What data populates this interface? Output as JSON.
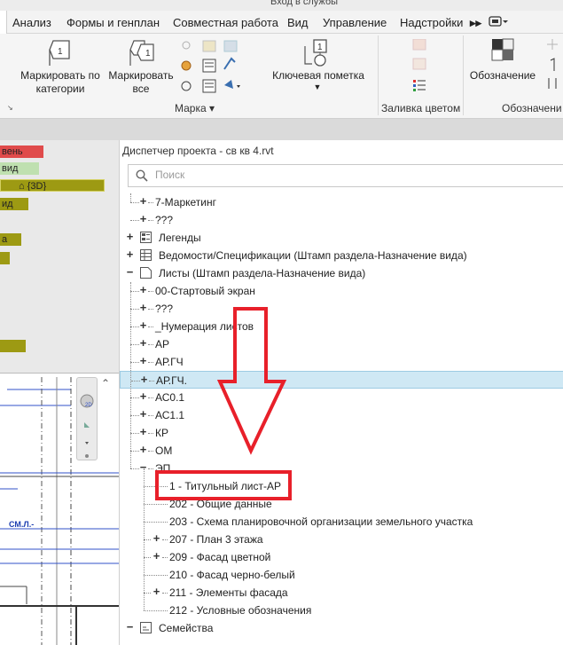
{
  "topstrip": {
    "text": "Вход в службы"
  },
  "ribbon_tabs": [
    "Анализ",
    "Формы и генплан",
    "Совместная работа",
    "Вид",
    "Управление",
    "Надстройки"
  ],
  "ribbon": {
    "tag_by_category": "Маркировать по категории",
    "tag_all": "Маркировать все",
    "keynote": "Ключевая пометка",
    "legend": "Обозначение",
    "panel_tag": "Марка",
    "panel_color_fill": "Заливка цветом",
    "panel_legend": "Обозначени"
  },
  "left_pane": {
    "labels": [
      "вень",
      "вид",
      "{3D}",
      "ид",
      "а"
    ],
    "view_annotation": "СМ.Л.-"
  },
  "browser": {
    "title": "Диспетчер проекта - св кв 4.rvt",
    "search_placeholder": "Поиск",
    "items": [
      {
        "label": "7-Маркетинг",
        "level": 1,
        "toggle": "+"
      },
      {
        "label": "???",
        "level": 1,
        "toggle": "+"
      },
      {
        "label": "Легенды",
        "level": 0,
        "toggle": "+",
        "icon": "legend-icon"
      },
      {
        "label": "Ведомости/Спецификации (Штамп раздела-Назначение вида)",
        "level": 0,
        "toggle": "+",
        "icon": "schedule-icon"
      },
      {
        "label": "Листы (Штамп раздела-Назначение вида)",
        "level": 0,
        "toggle": "-",
        "icon": "sheet-icon"
      },
      {
        "label": "00-Стартовый экран",
        "level": 1,
        "toggle": "+"
      },
      {
        "label": "???",
        "level": 1,
        "toggle": "+"
      },
      {
        "label": "_Нумерация листов",
        "level": 1,
        "toggle": "+"
      },
      {
        "label": "АР",
        "level": 1,
        "toggle": "+"
      },
      {
        "label": "АР.ГЧ",
        "level": 1,
        "toggle": "+"
      },
      {
        "label": "АР.ГЧ.",
        "level": 1,
        "toggle": "+",
        "selected": true
      },
      {
        "label": "АС0.1",
        "level": 1,
        "toggle": "+"
      },
      {
        "label": "АС1.1",
        "level": 1,
        "toggle": "+"
      },
      {
        "label": "КР",
        "level": 1,
        "toggle": "+"
      },
      {
        "label": "ОМ",
        "level": 1,
        "toggle": "+"
      },
      {
        "label": "ЭП",
        "level": 1,
        "toggle": "-"
      },
      {
        "label": "1 - Титульный лист-АР",
        "level": 2,
        "highlight": true
      },
      {
        "label": "202 - Общие данные",
        "level": 2
      },
      {
        "label": "203 - Схема планировочной организации земельного участка",
        "level": 2
      },
      {
        "label": "207 - План 3 этажа",
        "level": 2,
        "toggle": "+"
      },
      {
        "label": "209 - Фасад цветной",
        "level": 2,
        "toggle": "+"
      },
      {
        "label": "210 - Фасад черно-белый",
        "level": 2
      },
      {
        "label": "211 - Элементы фасада",
        "level": 2,
        "toggle": "+"
      },
      {
        "label": "212 - Условные обозначения",
        "level": 2
      },
      {
        "label": "Семейства",
        "level": 0,
        "toggle": "-",
        "icon": "family-icon"
      }
    ]
  },
  "colors": {
    "annotation_red": "#e8202a",
    "selection_bg": "#cfe8f4",
    "left_label_olive": "#9d9a13",
    "left_label_red": "#e04b4b",
    "left_label_green": "#bfe0b0"
  }
}
